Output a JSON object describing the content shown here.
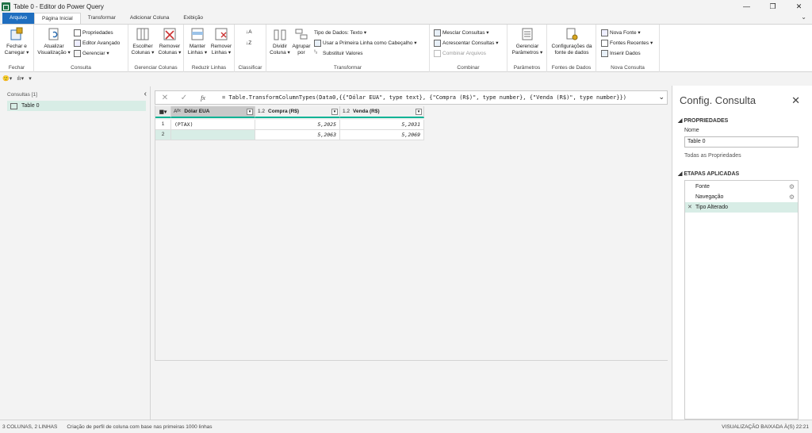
{
  "window": {
    "title": "Table 0 - Editor do Power Query",
    "minimize": "—",
    "restore": "❐",
    "close": "✕"
  },
  "menu": [
    "Arquivo",
    "Página Inicial",
    "Transformar",
    "Adicionar Coluna",
    "Exibição"
  ],
  "ribbon": {
    "fechar": {
      "btn": "Fechar e Carregar ▾",
      "group": "Fechar"
    },
    "consulta": {
      "atualizar": "Atualizar Visualização ▾",
      "propriedades": "Propriedades",
      "editor": "Editor Avançado",
      "gerenciar": "Gerenciar ▾",
      "group": "Consulta"
    },
    "gerenciar_colunas": {
      "escolher": "Escolher Colunas ▾",
      "remover": "Remover Colunas ▾",
      "group": "Gerenciar Colunas"
    },
    "reduzir_linhas": {
      "manter": "Manter Linhas ▾",
      "remover": "Remover Linhas ▾",
      "group": "Reduzir Linhas"
    },
    "classificar": {
      "group": "Classificar"
    },
    "transformar": {
      "dividir": "Dividir Coluna ▾",
      "agrupar": "Agrupar por",
      "tipo": "Tipo de Dados: Texto ▾",
      "primeira_linha": "Usar a Primeira Linha como Cabeçalho ▾",
      "substituir": "Substituir Valores",
      "group": "Transformar"
    },
    "combinar": {
      "mesclar": "Mesclar Consultas ▾",
      "acrescentar": "Acrescentar Consultas ▾",
      "combinar": "Combinar Arquivos",
      "group": "Combinar"
    },
    "parametros": {
      "gerenciar": "Gerenciar Parâmetros ▾",
      "group": "Parâmetros"
    },
    "fontes": {
      "config": "Configurações da fonte de dados",
      "group": "Fontes de Dados"
    },
    "nova_consulta": {
      "nova": "Nova Fonte ▾",
      "recentes": "Fontes Recentes ▾",
      "inserir": "Inserir Dados",
      "group": "Nova Consulta"
    }
  },
  "queries": {
    "header": "Consultas [1]",
    "items": [
      "Table 0"
    ]
  },
  "formula": "= Table.TransformColumnTypes(Data0,{{\"Dólar EUA\", type text}, {\"Compra (R$)\", type number}, {\"Venda (R$)\", type number}})",
  "grid": {
    "columns": [
      {
        "type": "Aᴮᶜ",
        "name": "Dólar EUA"
      },
      {
        "type": "1.2",
        "name": "Compra (R$)"
      },
      {
        "type": "1.2",
        "name": "Venda (R$)"
      }
    ],
    "rows": [
      {
        "n": "1",
        "cells": [
          "(PTAX)",
          "5,2025",
          "5,2031"
        ]
      },
      {
        "n": "2",
        "cells": [
          "",
          "5,2063",
          "5,2069"
        ]
      }
    ]
  },
  "settings": {
    "title": "Config. Consulta",
    "props_header": "PROPRIEDADES",
    "name_label": "Nome",
    "name_value": "Table 0",
    "all_props": "Todas as Propriedades",
    "steps_header": "ETAPAS APLICADAS",
    "steps": [
      "Fonte",
      "Navegação",
      "Tipo Alterado"
    ]
  },
  "status": {
    "left": "3 COLUNAS, 2 LINHAS",
    "mid": "Criação de perfil de coluna com base nas primeiras 1000 linhas",
    "right": "VISUALIZAÇÃO BAIXADA À(S) 22:21"
  },
  "colors": {
    "accent": "#00b294",
    "selected": "#d8ede6",
    "file_tab": "#1f6ebf"
  }
}
